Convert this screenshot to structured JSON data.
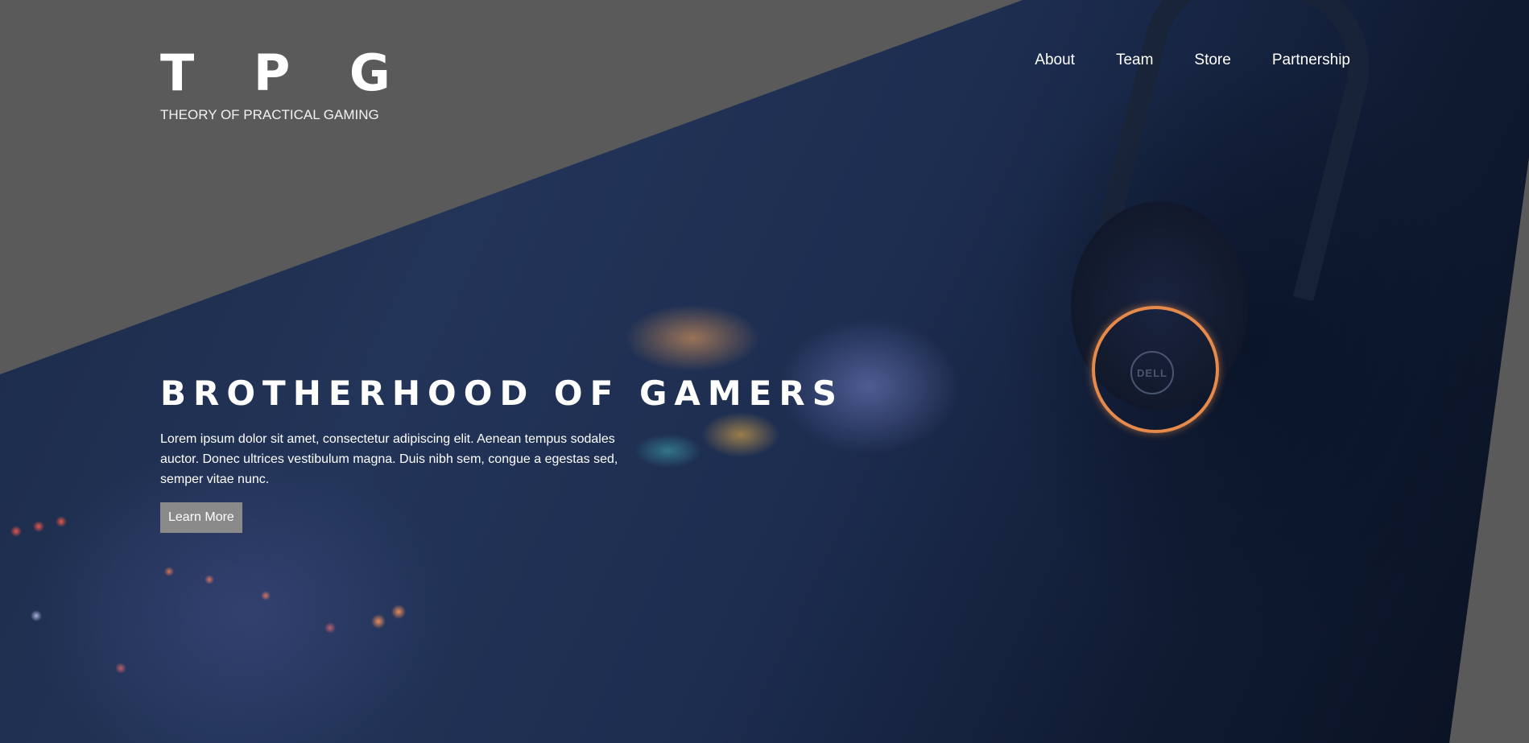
{
  "brand": {
    "title": "T P G",
    "tagline": "THEORY OF PRACTICAL GAMING"
  },
  "nav": {
    "items": [
      {
        "label": "About"
      },
      {
        "label": "Team"
      },
      {
        "label": "Store"
      },
      {
        "label": "Partnership"
      }
    ]
  },
  "hero": {
    "heading": "BROTHERHOOD OF GAMERS",
    "text": "Lorem ipsum dolor sit amet, consectetur adipiscing elit. Aenean tempus sodales auctor. Donec ultrices vestibulum magna. Duis nibh sem, congue a egestas sed, semper vitae nunc.",
    "button_label": "Learn More",
    "image_logo_text": "DELL"
  },
  "colors": {
    "background": "#5a5a5a",
    "button": "#8a8a8a",
    "text": "#ffffff",
    "accent_ring": "#e58a4a"
  }
}
